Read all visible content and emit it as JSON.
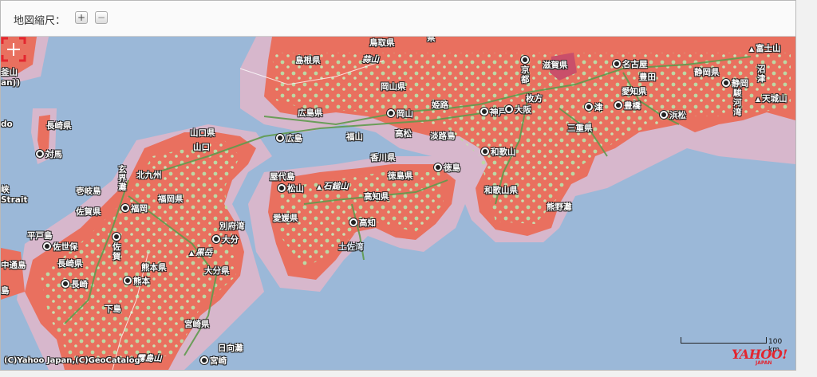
{
  "toolbar": {
    "scale_label": "地図縮尺：",
    "zoom_in": "+",
    "zoom_out": "−"
  },
  "map": {
    "colors": {
      "sea": "#9bb8d8",
      "land": "#e9705f",
      "coast_zone": "#d7b7cc",
      "green": "#bcd9a4",
      "roads": "#5f9b4d"
    },
    "labels": {
      "tottori_pref": "鳥取県",
      "shimane_pref": "島根県",
      "hiruzen": "蒜山",
      "okayama_pref": "岡山県",
      "hiroshima_pref": "広島県",
      "okayama": "岡山",
      "himeji": "姫路",
      "yamaguchi_pref": "山口県",
      "hiroshima": "広島",
      "fukuyama": "福山",
      "takamatsu": "高松",
      "awajishima": "淡路島",
      "yamaguchi": "山口",
      "kagawa_pref": "香川県",
      "tokushima_pref": "徳島県",
      "tokushima": "徳島",
      "yashirojima": "屋代島",
      "matsuyama": "松山",
      "ishizuchi": "石鎚山",
      "kochi_pref": "高知県",
      "ehime_pref": "愛媛県",
      "kochi": "高知",
      "tosawan": "土佐湾",
      "kitakyushu": "北九州",
      "genkainada": "玄界灘",
      "iki": "壱岐島",
      "fukuoka_pref": "福岡県",
      "saga_pref": "佐賀県",
      "fukuoka": "福岡",
      "beppuwan": "別府湾",
      "oita": "大分",
      "hiradoshima": "平戸島",
      "sasebo": "佐世保",
      "saga": "佐賀",
      "kuju": "黒岳",
      "kumamoto_pref": "熊本県",
      "oita_pref": "大分県",
      "nagasaki_pref_s": "長崎県",
      "nagasaki": "長崎",
      "kumamoto": "熊本",
      "shimojima": "下島",
      "miyazaki_pref": "宮崎県",
      "kirishima": "霧島山",
      "hyuganada": "日向灘",
      "miyazaki": "宮崎",
      "nagasaki_pref_n": "長崎県",
      "tsushima": "対馬",
      "busan": "釜山",
      "busan_sub": "an))",
      "do": "do",
      "strait_1": "峡",
      "strait_2": "Strait",
      "nakadori": "中通島",
      "fukue": "島",
      "kyoto": "京都",
      "shiga_pref": "滋賀県",
      "hirakata": "枚方",
      "kobe": "神戸",
      "osaka": "大阪",
      "nara_pref": "三重県",
      "tsu": "津",
      "wakayama": "和歌山",
      "wakayama_pref": "和歌山県",
      "kumanonada": "熊野灘",
      "nagoya": "名古屋",
      "toyota": "豊田",
      "aichi_pref": "愛知県",
      "toyohashi": "豊橋",
      "hamamatsu": "浜松",
      "shizuoka_pref": "静岡県",
      "shizuoka": "静岡",
      "fuji": "富士山",
      "numazu": "沼津",
      "surugawan": "駿河湾",
      "amagi": "天城山",
      "top_label": "県"
    },
    "scale": {
      "text": "100 km"
    },
    "credit": "(C)Yahoo Japan,(C)GeoCatalog",
    "logo": "YAHOO!",
    "logo_sub": "JAPAN"
  }
}
